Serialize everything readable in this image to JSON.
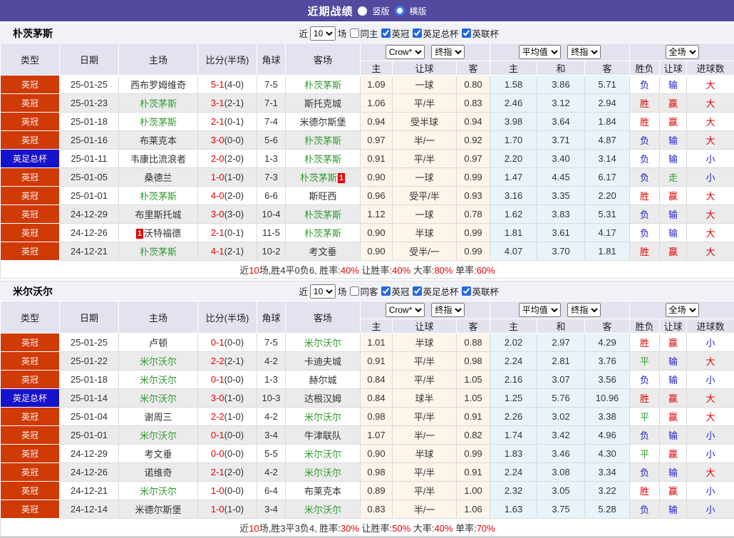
{
  "titlebar": {
    "title": "近期战绩",
    "radio_options": [
      {
        "label": "竖版",
        "selected": true
      },
      {
        "label": "横版",
        "selected": false
      }
    ]
  },
  "controls": {
    "near_label": "近",
    "matches_label": "场",
    "league_filters": [
      {
        "label": "英冠",
        "checked": true
      },
      {
        "label": "英足总杯",
        "checked": true
      },
      {
        "label": "英联杯",
        "checked": true
      }
    ]
  },
  "table_header": {
    "base_cols": [
      "类型",
      "日期",
      "主场",
      "比分(半场)",
      "角球",
      "客场"
    ],
    "group1": {
      "select1": "Crow*",
      "select2": "终指"
    },
    "group2": {
      "select1": "平均值",
      "select2": "终指"
    },
    "group3": {
      "select1": "全场"
    },
    "sub": [
      "主",
      "让球",
      "客",
      "主",
      "和",
      "客",
      "胜负",
      "让球",
      "进球数"
    ]
  },
  "colors": {
    "league_bg": {
      "英冠": "#cf3a06",
      "英足总杯": "#1512cc"
    },
    "focus_team": "#339933",
    "score_red": "#e60000",
    "result_text": {
      "胜": "#e00000",
      "平": "#339933",
      "负": "#2222cc",
      "赢": "#e00000",
      "走": "#339933",
      "输": "#2222cc",
      "大": "#e00000",
      "小": "#2222cc"
    }
  },
  "sections": [
    {
      "team": "朴茨茅斯",
      "match_count": "10",
      "same_label": "同主",
      "same_checked": false,
      "rows": [
        {
          "league": "英冠",
          "date": "25-01-25",
          "home": {
            "name": "西布罗姆维奇",
            "focus": false
          },
          "score": "5-1",
          "half": "(4-0)",
          "corner": "7-5",
          "away": {
            "name": "朴茨茅斯",
            "focus": true
          },
          "odds": [
            "1.09",
            "一球",
            "0.80"
          ],
          "avg": [
            "1.58",
            "3.86",
            "5.71"
          ],
          "results": [
            "负",
            "输",
            "大"
          ]
        },
        {
          "league": "英冠",
          "date": "25-01-23",
          "home": {
            "name": "朴茨茅斯",
            "focus": true
          },
          "score": "3-1",
          "half": "(2-1)",
          "corner": "7-1",
          "away": {
            "name": "斯托克城",
            "focus": false
          },
          "odds": [
            "1.06",
            "平/半",
            "0.83"
          ],
          "avg": [
            "2.46",
            "3.12",
            "2.94"
          ],
          "results": [
            "胜",
            "赢",
            "大"
          ]
        },
        {
          "league": "英冠",
          "date": "25-01-18",
          "home": {
            "name": "朴茨茅斯",
            "focus": true
          },
          "score": "2-1",
          "half": "(0-1)",
          "corner": "7-4",
          "away": {
            "name": "米德尔斯堡",
            "focus": false
          },
          "odds": [
            "0.94",
            "受半球",
            "0.94"
          ],
          "avg": [
            "3.98",
            "3.64",
            "1.84"
          ],
          "results": [
            "胜",
            "赢",
            "大"
          ]
        },
        {
          "league": "英冠",
          "date": "25-01-16",
          "home": {
            "name": "布莱克本",
            "focus": false
          },
          "score": "3-0",
          "half": "(0-0)",
          "corner": "5-6",
          "away": {
            "name": "朴茨茅斯",
            "focus": true
          },
          "odds": [
            "0.97",
            "半/一",
            "0.92"
          ],
          "avg": [
            "1.70",
            "3.71",
            "4.87"
          ],
          "results": [
            "负",
            "输",
            "大"
          ]
        },
        {
          "league": "英足总杯",
          "date": "25-01-11",
          "home": {
            "name": "韦康比流浪者",
            "focus": false
          },
          "score": "2-0",
          "half": "(2-0)",
          "corner": "1-3",
          "away": {
            "name": "朴茨茅斯",
            "focus": true
          },
          "odds": [
            "0.91",
            "平/半",
            "0.97"
          ],
          "avg": [
            "2.20",
            "3.40",
            "3.14"
          ],
          "results": [
            "负",
            "输",
            "小"
          ]
        },
        {
          "league": "英冠",
          "date": "25-01-05",
          "home": {
            "name": "桑德兰",
            "focus": false
          },
          "score": "1-0",
          "half": "(1-0)",
          "corner": "7-3",
          "away": {
            "name": "朴茨茅斯",
            "focus": true,
            "badge": "1",
            "badge_pos": "after"
          },
          "odds": [
            "0.90",
            "一球",
            "0.99"
          ],
          "avg": [
            "1.47",
            "4.45",
            "6.17"
          ],
          "results": [
            "负",
            "走",
            "小"
          ]
        },
        {
          "league": "英冠",
          "date": "25-01-01",
          "home": {
            "name": "朴茨茅斯",
            "focus": true
          },
          "score": "4-0",
          "half": "(2-0)",
          "corner": "6-6",
          "away": {
            "name": "斯旺西",
            "focus": false
          },
          "odds": [
            "0.96",
            "受平/半",
            "0.93"
          ],
          "avg": [
            "3.16",
            "3.35",
            "2.20"
          ],
          "results": [
            "胜",
            "赢",
            "大"
          ]
        },
        {
          "league": "英冠",
          "date": "24-12-29",
          "home": {
            "name": "布里斯托城",
            "focus": false
          },
          "score": "3-0",
          "half": "(3-0)",
          "corner": "10-4",
          "away": {
            "name": "朴茨茅斯",
            "focus": true
          },
          "odds": [
            "1.12",
            "一球",
            "0.78"
          ],
          "avg": [
            "1.62",
            "3.83",
            "5.31"
          ],
          "results": [
            "负",
            "输",
            "大"
          ]
        },
        {
          "league": "英冠",
          "date": "24-12-26",
          "home": {
            "name": "沃特福德",
            "focus": false,
            "badge": "1",
            "badge_pos": "before"
          },
          "score": "2-1",
          "half": "(0-1)",
          "corner": "11-5",
          "away": {
            "name": "朴茨茅斯",
            "focus": true
          },
          "odds": [
            "0.90",
            "半球",
            "0.99"
          ],
          "avg": [
            "1.81",
            "3.61",
            "4.17"
          ],
          "results": [
            "负",
            "输",
            "大"
          ]
        },
        {
          "league": "英冠",
          "date": "24-12-21",
          "home": {
            "name": "朴茨茅斯",
            "focus": true
          },
          "score": "4-1",
          "half": "(2-1)",
          "corner": "10-2",
          "away": {
            "name": "考文垂",
            "focus": false
          },
          "odds": [
            "0.90",
            "受半/一",
            "0.99"
          ],
          "avg": [
            "4.07",
            "3.70",
            "1.81"
          ],
          "results": [
            "胜",
            "赢",
            "大"
          ]
        }
      ],
      "summary": [
        {
          "text": "近",
          "red": false
        },
        {
          "text": "10",
          "red": true
        },
        {
          "text": "场,胜4平0负6, 胜率:",
          "red": false
        },
        {
          "text": "40%",
          "red": true
        },
        {
          "text": " 让胜率:",
          "red": false
        },
        {
          "text": "40%",
          "red": true
        },
        {
          "text": " 大率:",
          "red": false
        },
        {
          "text": "80%",
          "red": true
        },
        {
          "text": " 单率:",
          "red": false
        },
        {
          "text": "60%",
          "red": true
        }
      ]
    },
    {
      "team": "米尔沃尔",
      "match_count": "10",
      "same_label": "同客",
      "same_checked": false,
      "rows": [
        {
          "league": "英冠",
          "date": "25-01-25",
          "home": {
            "name": "卢顿",
            "focus": false
          },
          "score": "0-1",
          "half": "(0-0)",
          "corner": "7-5",
          "away": {
            "name": "米尔沃尔",
            "focus": true
          },
          "odds": [
            "1.01",
            "半球",
            "0.88"
          ],
          "avg": [
            "2.02",
            "2.97",
            "4.29"
          ],
          "results": [
            "胜",
            "赢",
            "小"
          ]
        },
        {
          "league": "英冠",
          "date": "25-01-22",
          "home": {
            "name": "米尔沃尔",
            "focus": true
          },
          "score": "2-2",
          "half": "(2-1)",
          "corner": "4-2",
          "away": {
            "name": "卡迪夫城",
            "focus": false
          },
          "odds": [
            "0.91",
            "平/半",
            "0.98"
          ],
          "avg": [
            "2.24",
            "2.81",
            "3.76"
          ],
          "results": [
            "平",
            "输",
            "大"
          ]
        },
        {
          "league": "英冠",
          "date": "25-01-18",
          "home": {
            "name": "米尔沃尔",
            "focus": true
          },
          "score": "0-1",
          "half": "(0-0)",
          "corner": "1-3",
          "away": {
            "name": "赫尔城",
            "focus": false
          },
          "odds": [
            "0.84",
            "平/半",
            "1.05"
          ],
          "avg": [
            "2.16",
            "3.07",
            "3.56"
          ],
          "results": [
            "负",
            "输",
            "小"
          ]
        },
        {
          "league": "英足总杯",
          "date": "25-01-14",
          "home": {
            "name": "米尔沃尔",
            "focus": true
          },
          "score": "3-0",
          "half": "(1-0)",
          "corner": "10-3",
          "away": {
            "name": "达根汉姆",
            "focus": false
          },
          "odds": [
            "0.84",
            "球半",
            "1.05"
          ],
          "avg": [
            "1.25",
            "5.76",
            "10.96"
          ],
          "results": [
            "胜",
            "赢",
            "大"
          ]
        },
        {
          "league": "英冠",
          "date": "25-01-04",
          "home": {
            "name": "谢周三",
            "focus": false
          },
          "score": "2-2",
          "half": "(1-0)",
          "corner": "4-2",
          "away": {
            "name": "米尔沃尔",
            "focus": true
          },
          "odds": [
            "0.98",
            "平/半",
            "0.91"
          ],
          "avg": [
            "2.26",
            "3.02",
            "3.38"
          ],
          "results": [
            "平",
            "赢",
            "大"
          ]
        },
        {
          "league": "英冠",
          "date": "25-01-01",
          "home": {
            "name": "米尔沃尔",
            "focus": true
          },
          "score": "0-1",
          "half": "(0-0)",
          "corner": "3-4",
          "away": {
            "name": "牛津联队",
            "focus": false
          },
          "odds": [
            "1.07",
            "半/一",
            "0.82"
          ],
          "avg": [
            "1.74",
            "3.42",
            "4.96"
          ],
          "results": [
            "负",
            "输",
            "小"
          ]
        },
        {
          "league": "英冠",
          "date": "24-12-29",
          "home": {
            "name": "考文垂",
            "focus": false
          },
          "score": "0-0",
          "half": "(0-0)",
          "corner": "5-5",
          "away": {
            "name": "米尔沃尔",
            "focus": true
          },
          "odds": [
            "0.90",
            "半球",
            "0.99"
          ],
          "avg": [
            "1.83",
            "3.46",
            "4.30"
          ],
          "results": [
            "平",
            "赢",
            "小"
          ]
        },
        {
          "league": "英冠",
          "date": "24-12-26",
          "home": {
            "name": "诺维奇",
            "focus": false
          },
          "score": "2-1",
          "half": "(2-0)",
          "corner": "4-2",
          "away": {
            "name": "米尔沃尔",
            "focus": true
          },
          "odds": [
            "0.98",
            "平/半",
            "0.91"
          ],
          "avg": [
            "2.24",
            "3.08",
            "3.34"
          ],
          "results": [
            "负",
            "输",
            "大"
          ]
        },
        {
          "league": "英冠",
          "date": "24-12-21",
          "home": {
            "name": "米尔沃尔",
            "focus": true
          },
          "score": "1-0",
          "half": "(0-0)",
          "corner": "6-4",
          "away": {
            "name": "布莱克本",
            "focus": false
          },
          "odds": [
            "0.89",
            "平/半",
            "1.00"
          ],
          "avg": [
            "2.32",
            "3.05",
            "3.22"
          ],
          "results": [
            "胜",
            "赢",
            "小"
          ]
        },
        {
          "league": "英冠",
          "date": "24-12-14",
          "home": {
            "name": "米德尔斯堡",
            "focus": false
          },
          "score": "1-0",
          "half": "(1-0)",
          "corner": "3-4",
          "away": {
            "name": "米尔沃尔",
            "focus": true
          },
          "odds": [
            "0.83",
            "半/一",
            "1.06"
          ],
          "avg": [
            "1.63",
            "3.75",
            "5.28"
          ],
          "results": [
            "负",
            "输",
            "小"
          ]
        }
      ],
      "summary": [
        {
          "text": "近",
          "red": false
        },
        {
          "text": "10",
          "red": true
        },
        {
          "text": "场,胜3平3负4, 胜率:",
          "red": false
        },
        {
          "text": "30%",
          "red": true
        },
        {
          "text": " 让胜率:",
          "red": false
        },
        {
          "text": "50%",
          "red": true
        },
        {
          "text": " 大率:",
          "red": false
        },
        {
          "text": "40%",
          "red": true
        },
        {
          "text": " 单率:",
          "red": false
        },
        {
          "text": "70%",
          "red": true
        }
      ]
    }
  ]
}
